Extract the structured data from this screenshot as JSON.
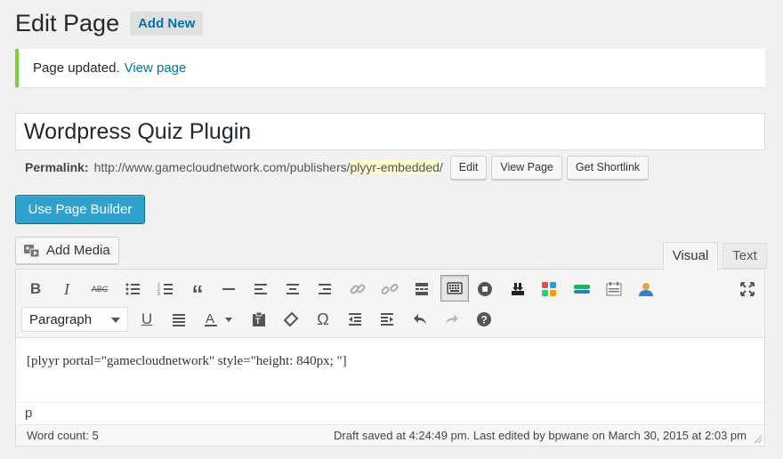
{
  "header": {
    "title": "Edit Page",
    "add_new": "Add New"
  },
  "notice": {
    "text": "Page updated.",
    "link": "View page",
    "accent": "#7ad03a"
  },
  "post": {
    "title": "Wordpress Quiz Plugin"
  },
  "permalink": {
    "label": "Permalink:",
    "base_url": "http://www.gamecloudnetwork.com/publishers/",
    "slug": "plyyr-embedded",
    "trailing": "/",
    "edit": "Edit",
    "view": "View Page",
    "shortlink": "Get Shortlink"
  },
  "page_builder": {
    "label": "Use Page Builder",
    "color": "#2ea2cc"
  },
  "media": {
    "label": "Add Media",
    "icon": "media-icon"
  },
  "tabs": {
    "visual": "Visual",
    "text": "Text"
  },
  "toolbar": {
    "format_select": "Paragraph",
    "row1_icons": [
      "bold-icon",
      "italic-icon",
      "strikethrough-icon",
      "bullet-list-icon",
      "numbered-list-icon",
      "blockquote-icon",
      "horizontal-rule-icon",
      "align-left-icon",
      "align-center-icon",
      "align-right-icon",
      "link-icon",
      "unlink-icon",
      "read-more-icon",
      "toolbar-toggle-icon",
      "plugin-circle-icon",
      "download-icon",
      "grid-plugin-icon",
      "button-plugin-icon",
      "form-plugin-icon",
      "user-plugin-icon",
      "fullscreen-icon"
    ],
    "row2_icons": [
      "underline-icon",
      "justify-icon",
      "text-color-icon",
      "paste-text-icon",
      "clear-format-icon",
      "special-char-icon",
      "outdent-icon",
      "indent-icon",
      "undo-icon",
      "redo-icon",
      "help-icon"
    ]
  },
  "editor": {
    "content": "[plyyr portal=\"gamecloudnetwork\" style=\"height: 840px; \"]",
    "path": "p",
    "word_count": "Word count: 5",
    "status": "Draft saved at 4:24:49 pm. Last edited by bpwane on March 30, 2015 at 2:03 pm"
  }
}
